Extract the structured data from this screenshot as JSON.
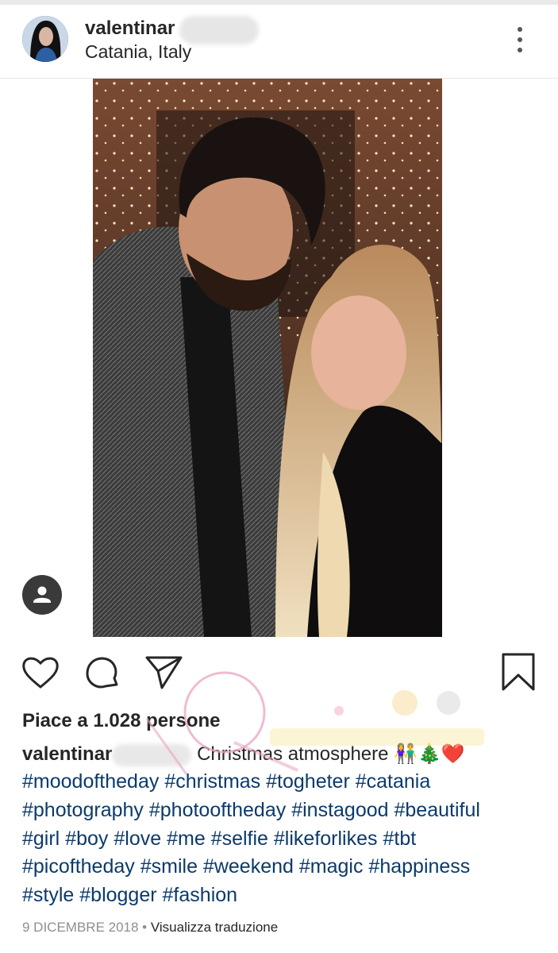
{
  "post": {
    "username": "valentinar",
    "location": "Catania, Italy",
    "likes_text": "Piace a 1.028 persone",
    "caption_user": "valentinar",
    "caption_text": "Christmas atmosphere 👫🎄❤️",
    "hashtags": [
      "#moodoftheday",
      "#christmas",
      "#togheter",
      "#catania",
      "#photography",
      "#photooftheday",
      "#instagood",
      "#beautiful",
      "#girl",
      "#boy",
      "#love",
      "#me",
      "#selfie",
      "#likeforlikes",
      "#tbt",
      "#picoftheday",
      "#smile",
      "#weekend",
      "#magic",
      "#happiness",
      "#style",
      "#blogger",
      "#fashion"
    ],
    "date": "9 DICEMBRE 2018",
    "separator": " • ",
    "translate_label": "Visualizza traduzione"
  },
  "icons": [
    "more-options-icon",
    "tag-people-icon",
    "heart-icon",
    "comment-icon",
    "share-icon",
    "bookmark-icon"
  ],
  "colors": {
    "text": "#262626",
    "hashtag": "#0b3a6b",
    "meta": "#8e8e8e",
    "divider": "#e6e6e6"
  }
}
